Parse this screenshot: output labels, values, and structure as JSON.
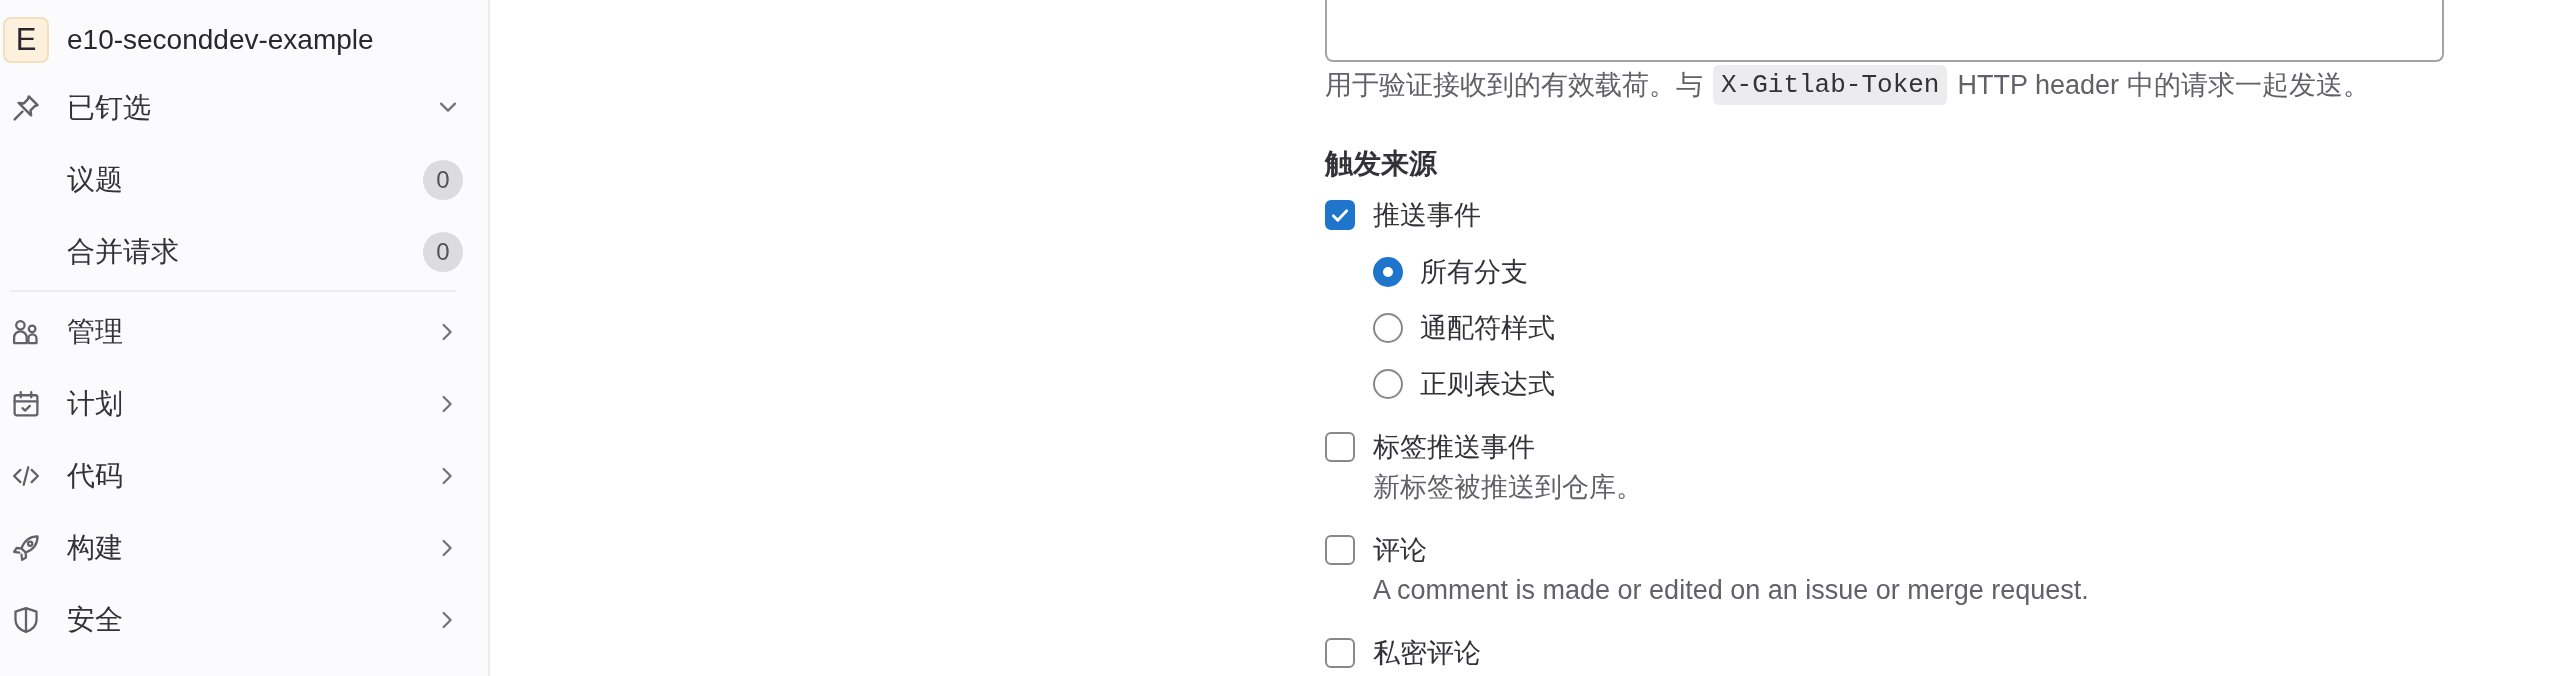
{
  "sidebar": {
    "project": {
      "avatar": "E",
      "name": "e10-seconddev-example"
    },
    "pinned": {
      "label": "已钉选",
      "expanded": true,
      "items": [
        {
          "label": "议题",
          "count": "0"
        },
        {
          "label": "合并请求",
          "count": "0"
        }
      ]
    },
    "nav": [
      {
        "label": "管理",
        "expanded": false
      },
      {
        "label": "计划",
        "expanded": false
      },
      {
        "label": "代码",
        "expanded": false
      },
      {
        "label": "构建",
        "expanded": false
      },
      {
        "label": "安全",
        "expanded": false
      }
    ]
  },
  "form": {
    "secret_token": {
      "help_before": "用于验证接收到的有效载荷。与",
      "help_code": "X-Gitlab-Token",
      "help_after": "HTTP header 中的请求一起发送。"
    },
    "trigger": {
      "title": "触发来源",
      "options": [
        {
          "label": "推送事件",
          "checked": true,
          "branches": [
            {
              "label": "所有分支",
              "selected": true
            },
            {
              "label": "通配符样式",
              "selected": false
            },
            {
              "label": "正则表达式",
              "selected": false
            }
          ]
        },
        {
          "label": "标签推送事件",
          "checked": false,
          "help": "新标签被推送到仓库。"
        },
        {
          "label": "评论",
          "checked": false,
          "help": "A comment is made or edited on an issue or merge request."
        },
        {
          "label": "私密评论",
          "checked": false
        }
      ]
    }
  }
}
